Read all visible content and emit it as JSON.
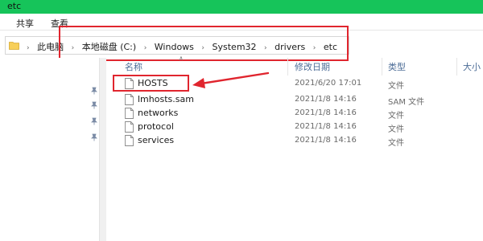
{
  "window": {
    "title": "etc"
  },
  "ribbon": {
    "tabs": [
      "共享",
      "查看"
    ]
  },
  "address": {
    "crumbs": [
      "此电脑",
      "本地磁盘 (C:)",
      "Windows",
      "System32",
      "drivers",
      "etc"
    ]
  },
  "columns": {
    "name": "名称",
    "modified": "修改日期",
    "type": "类型",
    "size": "大小"
  },
  "files": [
    {
      "name": "HOSTS",
      "modified": "2021/6/20 17:01",
      "type": "文件"
    },
    {
      "name": "lmhosts.sam",
      "modified": "2021/1/8 14:16",
      "type": "SAM 文件"
    },
    {
      "name": "networks",
      "modified": "2021/1/8 14:16",
      "type": "文件"
    },
    {
      "name": "protocol",
      "modified": "2021/1/8 14:16",
      "type": "文件"
    },
    {
      "name": "services",
      "modified": "2021/1/8 14:16",
      "type": "文件"
    }
  ],
  "colors": {
    "titlebar": "#16c45a",
    "annotation": "#e0252e",
    "header_text": "#4d6d97"
  },
  "icons": {
    "address": "folder-icon",
    "file": "document-icon",
    "nav": "pin-icon"
  }
}
